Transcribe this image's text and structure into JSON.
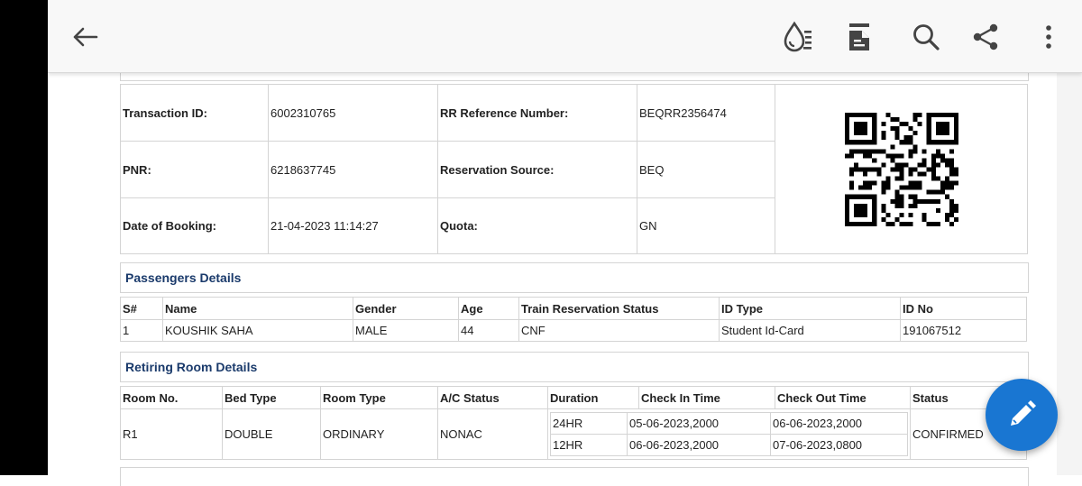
{
  "booking": {
    "transaction_id_label": "Transaction ID:",
    "transaction_id": "6002310765",
    "rr_ref_label": "RR Reference Number:",
    "rr_ref": "BEQRR2356474",
    "pnr_label": "PNR:",
    "pnr": "6218637745",
    "res_source_label": "Reservation Source:",
    "res_source": "BEQ",
    "date_label": "Date of Booking:",
    "date": "21-04-2023 11:14:27",
    "quota_label": "Quota:",
    "quota": "GN"
  },
  "passengers": {
    "title": "Passengers Details",
    "headers": [
      "S#",
      "Name",
      "Gender",
      "Age",
      "Train Reservation Status",
      "ID Type",
      "ID No"
    ],
    "rows": [
      [
        "1",
        "KOUSHIK SAHA",
        "MALE",
        "44",
        "CNF",
        "Student Id-Card",
        "191067512"
      ]
    ]
  },
  "retiring": {
    "title": "Retiring Room Details",
    "headers": [
      "Room No.",
      "Bed Type",
      "Room Type",
      "A/C Status",
      "Duration",
      "Check In Time",
      "Check Out Time",
      "Status"
    ],
    "room_no": "R1",
    "bed_type": "DOUBLE",
    "room_type": "ORDINARY",
    "ac_status": "NONAC",
    "status": "CONFIRMED",
    "slots": [
      {
        "duration": "24HR",
        "check_in": "05-06-2023,2000",
        "check_out": "06-06-2023,2000"
      },
      {
        "duration": "12HR",
        "check_in": "06-06-2023,2000",
        "check_out": "07-06-2023,0800"
      }
    ]
  },
  "colors": {
    "accent": "#1976d2",
    "section_title": "#1a3a6b"
  },
  "icons": [
    "back-arrow-icon",
    "ink-drop-icon",
    "page-layout-icon",
    "search-icon",
    "share-icon",
    "more-vert-icon",
    "edit-pencil-icon"
  ]
}
